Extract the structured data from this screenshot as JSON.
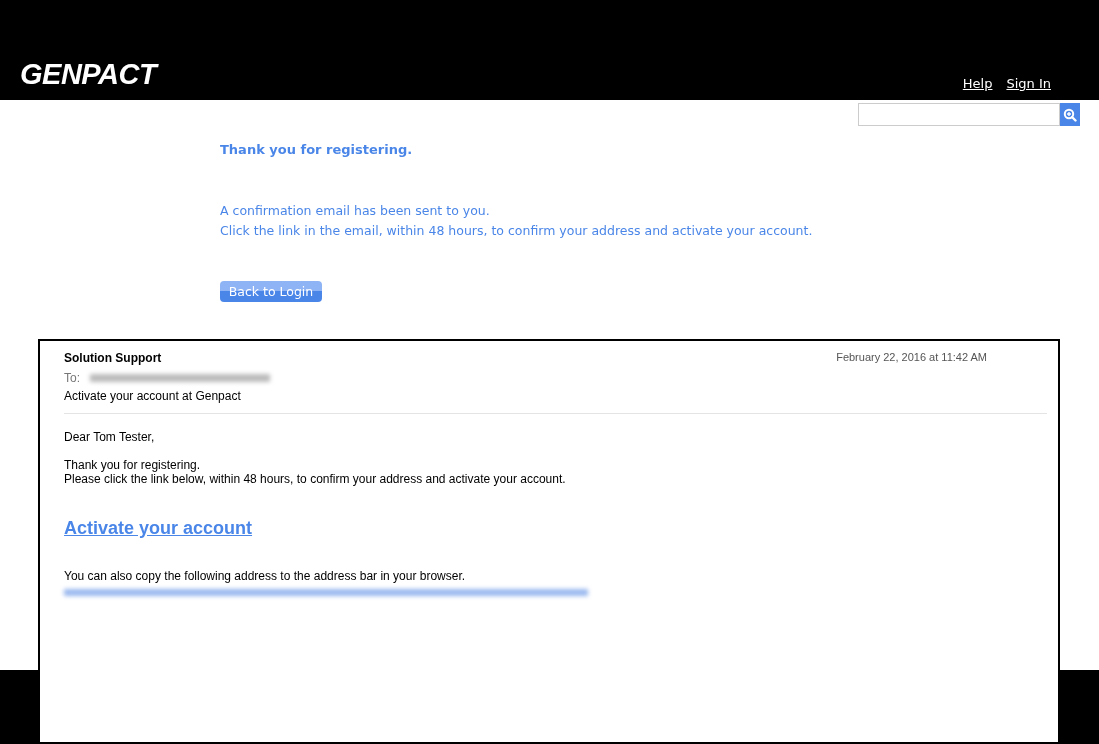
{
  "header": {
    "logo": "GENPACT",
    "links": [
      {
        "label": "Help"
      },
      {
        "label": "Sign In"
      }
    ]
  },
  "confirmation": {
    "title": "Thank you for registering.",
    "lines": [
      "A confirmation email has been sent to you.",
      "Click the link in the email, within 48 hours, to confirm your address and activate your account."
    ],
    "button": "Back to Login"
  },
  "email": {
    "sender": "Solution Support",
    "date": "February 22, 2016 at 11:42 AM",
    "to_label": "To:",
    "subject": "Activate your account at Genpact",
    "greeting": "Dear Tom Tester,",
    "body_lines": [
      "Thank you for registering.",
      "Please click the link below, within 48 hours, to confirm your address and activate your account."
    ],
    "link": "Activate your account",
    "copy_note": "You can also copy the following address to the address bar in your browser."
  }
}
